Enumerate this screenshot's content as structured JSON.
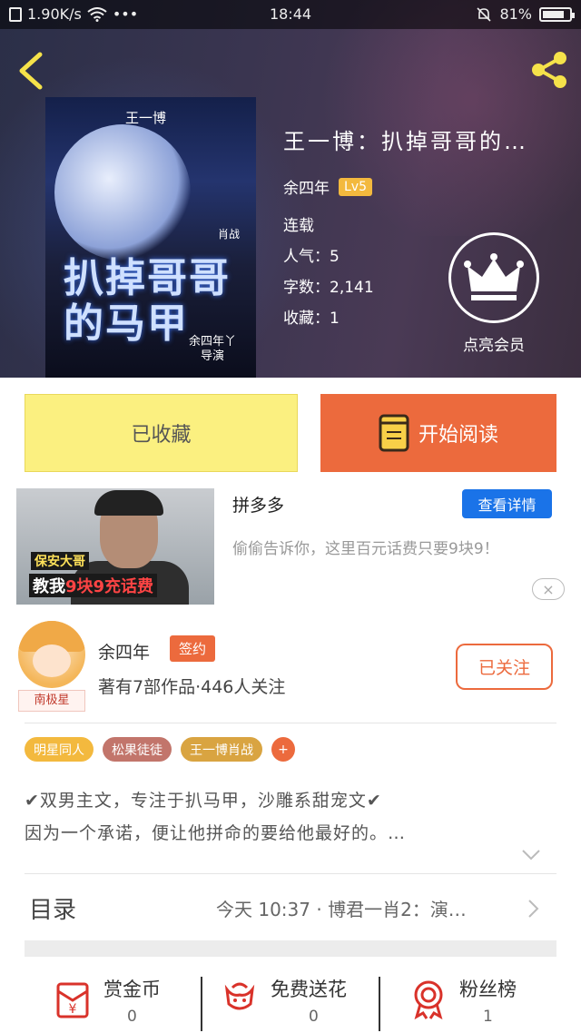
{
  "status_bar": {
    "speed": "1.90K/s",
    "dots": "•••",
    "time": "18:44",
    "battery": "81%",
    "battery_level": 0.81
  },
  "book": {
    "title": "王一博：扒掉哥哥的…",
    "author": "余四年",
    "level": "Lv5",
    "status": "连载",
    "popularity": "人气：5",
    "word_count": "字数：2,141",
    "favorites": "收藏：1",
    "vip_label": "点亮会员"
  },
  "cover": {
    "top_text": "王一博",
    "side_text": "肖战",
    "big_text": "扒掉哥哥的马甲",
    "credit_line1": "余四年丫",
    "credit_line2": "导演"
  },
  "actions": {
    "collected": "已收藏",
    "start_reading": "开始阅读"
  },
  "ad": {
    "caption1": "保安大哥",
    "caption2_pre": "教我",
    "caption2_hl": "9块9充话费",
    "name": "拼多多",
    "detail_button": "查看详情",
    "description": "偷偷告诉你，这里百元话费只要9块9！",
    "close": "×"
  },
  "author": {
    "avatar_tag": "南极星",
    "name": "余四年",
    "signed_badge": "签约",
    "stats": "著有7部作品·446人关注",
    "follow_button": "已关注"
  },
  "tags": [
    {
      "label": "明星同人",
      "color": "#f3b93e"
    },
    {
      "label": "松果徒徒",
      "color": "#c2756b"
    },
    {
      "label": "王一博肖战",
      "color": "#d9a441"
    },
    {
      "label": "+",
      "color": "#ec6a3d"
    }
  ],
  "intro": {
    "line1": "✔双男主文，专注于扒马甲，沙雕系甜宠文✔",
    "line2": "因为一个承诺，便让他拼命的要给他最好的。…"
  },
  "toc": {
    "label": "目录",
    "latest": "今天 10:37 · 博君一肖2：演…"
  },
  "bottom_bar": {
    "coins": {
      "label": "赏金币",
      "count": "0"
    },
    "flowers": {
      "label": "免费送花",
      "count": "0"
    },
    "fans": {
      "label": "粉丝榜",
      "count": "1"
    }
  },
  "colors": {
    "accent": "#ec6a3d",
    "collected_bg": "#fbf080",
    "detail_blue": "#1a73e8",
    "hero_bg": "#2b2f48"
  }
}
